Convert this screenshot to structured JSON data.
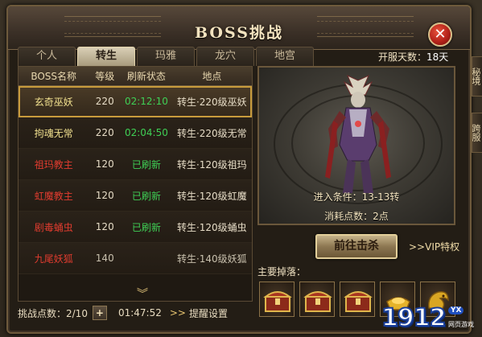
{
  "window": {
    "title": "BOSS挑战"
  },
  "tabs": [
    {
      "label": "个人",
      "active": false
    },
    {
      "label": "转生",
      "active": true
    },
    {
      "label": "玛雅",
      "active": false
    },
    {
      "label": "龙穴",
      "active": false
    },
    {
      "label": "地宫",
      "active": false
    }
  ],
  "server_days": {
    "label": "开服天数：",
    "value": "18天"
  },
  "table": {
    "headers": {
      "name": "BOSS名称",
      "level": "等级",
      "status": "刷新状态",
      "location": "地点"
    },
    "rows": [
      {
        "name": "玄奇巫妖",
        "level": "220",
        "status": "02:12:10",
        "location": "转生·220级巫妖",
        "name_color": "yellow",
        "selected": true
      },
      {
        "name": "拘魂无常",
        "level": "220",
        "status": "02:04:50",
        "location": "转生·220级无常",
        "name_color": "yellow",
        "selected": false
      },
      {
        "name": "祖玛教主",
        "level": "120",
        "status": "已刷新",
        "location": "转生·120级祖玛",
        "name_color": "red",
        "selected": false
      },
      {
        "name": "虹魔教主",
        "level": "120",
        "status": "已刷新",
        "location": "转生·120级虹魔",
        "name_color": "red",
        "selected": false
      },
      {
        "name": "剧毒蛹虫",
        "level": "120",
        "status": "已刷新",
        "location": "转生·120级蛹虫",
        "name_color": "red",
        "selected": false
      },
      {
        "name": "九尾妖狐",
        "level": "140",
        "status": "",
        "location": "转生·140级妖狐",
        "name_color": "red",
        "selected": false
      }
    ]
  },
  "footer": {
    "challenge_points": "挑战点数：2/10",
    "plus": "+",
    "timer": "01:47:52",
    "remind_arrows": ">>",
    "remind": "提醒设置"
  },
  "preview": {
    "condition": "进入条件：13-13转",
    "cost": "消耗点数：2点"
  },
  "actions": {
    "go": "前往击杀",
    "vip": ">>VIP特权"
  },
  "drops": {
    "label": "主要掉落：",
    "items": [
      "chest-icon",
      "chest-icon",
      "chest-icon",
      "gold-ingot-icon",
      "golden-dragon-icon"
    ]
  },
  "side_tabs": [
    "秘境",
    "跨服"
  ],
  "watermark": {
    "logo": "1912",
    "badge": "YX",
    "sub": "网页游戏"
  }
}
